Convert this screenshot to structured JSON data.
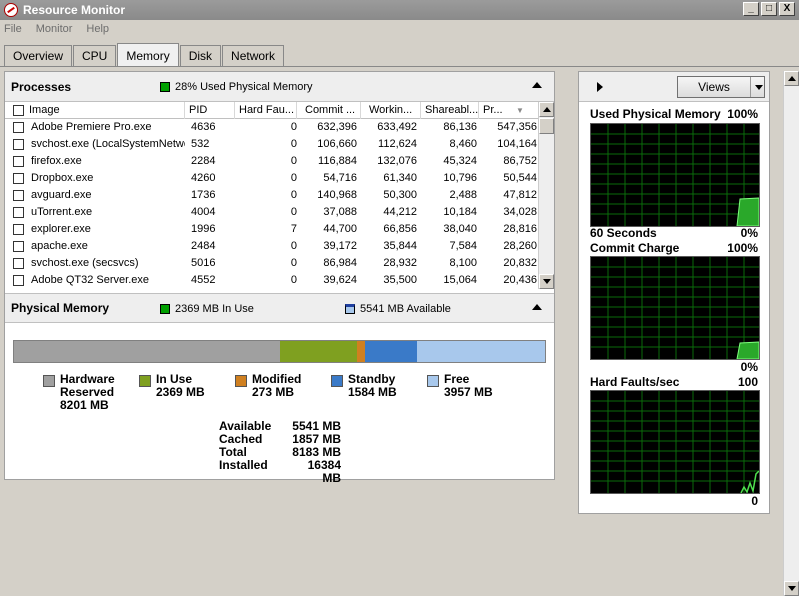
{
  "window": {
    "title": "Resource Monitor",
    "controls": [
      "_",
      "□",
      "X"
    ]
  },
  "menu": [
    "File",
    "Monitor",
    "Help"
  ],
  "tabs": [
    "Overview",
    "CPU",
    "Memory",
    "Disk",
    "Network"
  ],
  "processes": {
    "title": "Processes",
    "status": "28% Used Physical Memory",
    "status_color": "#00a000",
    "columns": [
      "Image",
      "PID",
      "Hard Fau...",
      "Commit ...",
      "Workin...",
      "Shareabl...",
      "Pr..."
    ],
    "rows": [
      [
        "Adobe Premiere Pro.exe",
        "4636",
        "0",
        "632,396",
        "633,492",
        "86,136",
        "547,356"
      ],
      [
        "svchost.exe (LocalSystemNetwo...",
        "532",
        "0",
        "106,660",
        "112,624",
        "8,460",
        "104,164"
      ],
      [
        "firefox.exe",
        "2284",
        "0",
        "116,884",
        "132,076",
        "45,324",
        "86,752"
      ],
      [
        "Dropbox.exe",
        "4260",
        "0",
        "54,716",
        "61,340",
        "10,796",
        "50,544"
      ],
      [
        "avguard.exe",
        "1736",
        "0",
        "140,968",
        "50,300",
        "2,488",
        "47,812"
      ],
      [
        "uTorrent.exe",
        "4004",
        "0",
        "37,088",
        "44,212",
        "10,184",
        "34,028"
      ],
      [
        "explorer.exe",
        "1996",
        "7",
        "44,700",
        "66,856",
        "38,040",
        "28,816"
      ],
      [
        "apache.exe",
        "2484",
        "0",
        "39,172",
        "35,844",
        "7,584",
        "28,260"
      ],
      [
        "svchost.exe (secsvcs)",
        "5016",
        "0",
        "86,984",
        "28,932",
        "8,100",
        "20,832"
      ],
      [
        "Adobe QT32 Server.exe",
        "4552",
        "0",
        "39,624",
        "35,500",
        "15,064",
        "20,436"
      ]
    ]
  },
  "physical_memory": {
    "title": "Physical Memory",
    "in_use_status": "2369 MB In Use",
    "available_status": "5541 MB Available",
    "bar_segments": [
      {
        "name": "Hardware Reserved",
        "mb": 8201,
        "color": "#a0a0a0"
      },
      {
        "name": "In Use",
        "mb": 2369,
        "color": "#7fa020"
      },
      {
        "name": "Modified",
        "mb": 273,
        "color": "#d08020"
      },
      {
        "name": "Standby",
        "mb": 1584,
        "color": "#3a7ac8"
      },
      {
        "name": "Free",
        "mb": 3957,
        "color": "#a8c8ec"
      }
    ],
    "legend": [
      {
        "line1": "Hardware",
        "line2": "Reserved",
        "value": "8201 MB",
        "color": "#a0a0a0"
      },
      {
        "line1": "In Use",
        "line2": "",
        "value": "2369 MB",
        "color": "#7fa020"
      },
      {
        "line1": "Modified",
        "line2": "",
        "value": "273 MB",
        "color": "#d08020"
      },
      {
        "line1": "Standby",
        "line2": "",
        "value": "1584 MB",
        "color": "#3a7ac8"
      },
      {
        "line1": "Free",
        "line2": "",
        "value": "3957 MB",
        "color": "#a8c8ec"
      }
    ],
    "totals": [
      {
        "label": "Available",
        "value": "5541 MB"
      },
      {
        "label": "Cached",
        "value": "1857 MB"
      },
      {
        "label": "Total",
        "value": "8183 MB"
      },
      {
        "label": "Installed",
        "value": "16384 MB"
      }
    ]
  },
  "right_panel": {
    "views_label": "Views",
    "graphs": [
      {
        "title": "Used Physical Memory",
        "max": "100%",
        "min": "0%",
        "time_label": "60 Seconds"
      },
      {
        "title": "Commit Charge",
        "max": "100%",
        "min": "0%",
        "time_label": ""
      },
      {
        "title": "Hard Faults/sec",
        "max": "100",
        "min": "0",
        "time_label": ""
      }
    ]
  }
}
